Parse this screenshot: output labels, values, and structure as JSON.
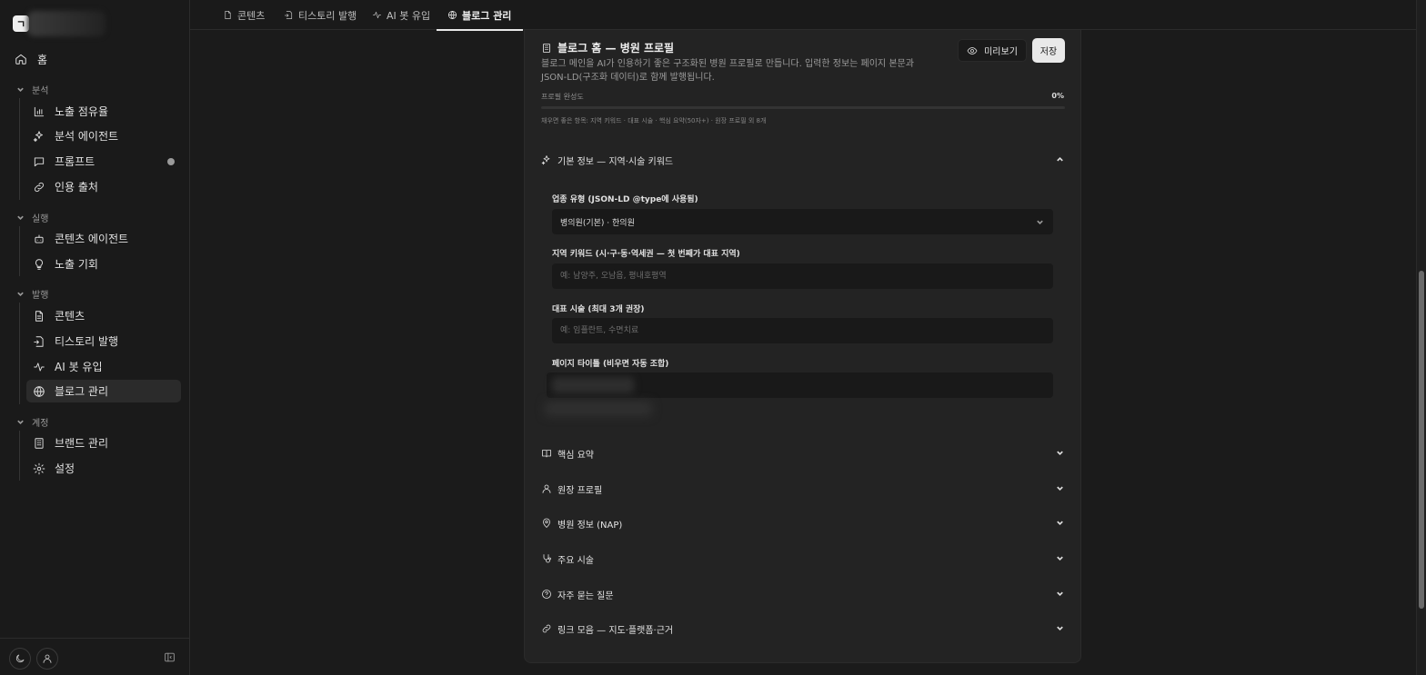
{
  "sidebar": {
    "logo_char": "ㄱ",
    "home": "홈",
    "groups": [
      {
        "label": "분석",
        "items": [
          "노출 점유율",
          "분석 에이전트",
          "프롬프트",
          "인용 출처"
        ]
      },
      {
        "label": "실행",
        "items": [
          "콘텐츠 에이전트",
          "노출 기회"
        ]
      },
      {
        "label": "발행",
        "items": [
          "콘텐츠",
          "티스토리 발행",
          "AI 봇 유입",
          "블로그 관리"
        ]
      },
      {
        "label": "계정",
        "items": [
          "브랜드 관리",
          "설정"
        ]
      }
    ],
    "active_item": "블로그 관리"
  },
  "tabs": [
    {
      "label": "콘텐츠",
      "icon": "file-icon"
    },
    {
      "label": "티스토리 발행",
      "icon": "share-file-icon"
    },
    {
      "label": "AI 봇 유입",
      "icon": "activity-icon"
    },
    {
      "label": "블로그 관리",
      "icon": "globe-icon",
      "active": true
    }
  ],
  "card": {
    "title": "블로그 홈 — 병원 프로필",
    "description": "블로그 메인을 AI가 인용하기 좋은 구조화된 병원 프로필로 만듭니다. 입력한 정보는 페이지 본문과 JSON-LD(구조화 데이터)로 함께 발행됩니다.",
    "preview_button": "미리보기",
    "save_button": "저장",
    "progress_label": "프로필 완성도",
    "progress_value": "0%",
    "progress_fraction": 0,
    "progress_hint": "채우면 좋은 항목: 지역 키워드 · 대표 시술 · 핵심 요약(50자+) · 원장 프로필 외 8개",
    "basic_section": {
      "title": "기본 정보 — 지역·시술 키워드",
      "fields": {
        "type_label": "업종 유형 (JSON-LD @type에 사용됨)",
        "type_value": "병의원(기본) · 한의원",
        "region_label": "지역 키워드 (시·구·동·역세권 — 첫 번째가 대표 지역)",
        "region_placeholder": "예: 남양주, 오남읍, 평내호평역",
        "treatment_label": "대표 시술 (최대 3개 권장)",
        "treatment_placeholder": "예: 임플란트, 수면치료",
        "page_title_label": "페이지 타이틀 (비우면 자동 조합)"
      }
    },
    "sections": [
      {
        "title": "핵심 요약",
        "icon": "book-icon"
      },
      {
        "title": "원장 프로필",
        "icon": "user-icon"
      },
      {
        "title": "병원 정보 (NAP)",
        "icon": "map-pin-icon"
      },
      {
        "title": "주요 시술",
        "icon": "stethoscope-icon"
      },
      {
        "title": "자주 묻는 질문",
        "icon": "help-circle-icon"
      },
      {
        "title": "링크 모음 — 지도·플랫폼·근거",
        "icon": "link-icon"
      }
    ]
  }
}
